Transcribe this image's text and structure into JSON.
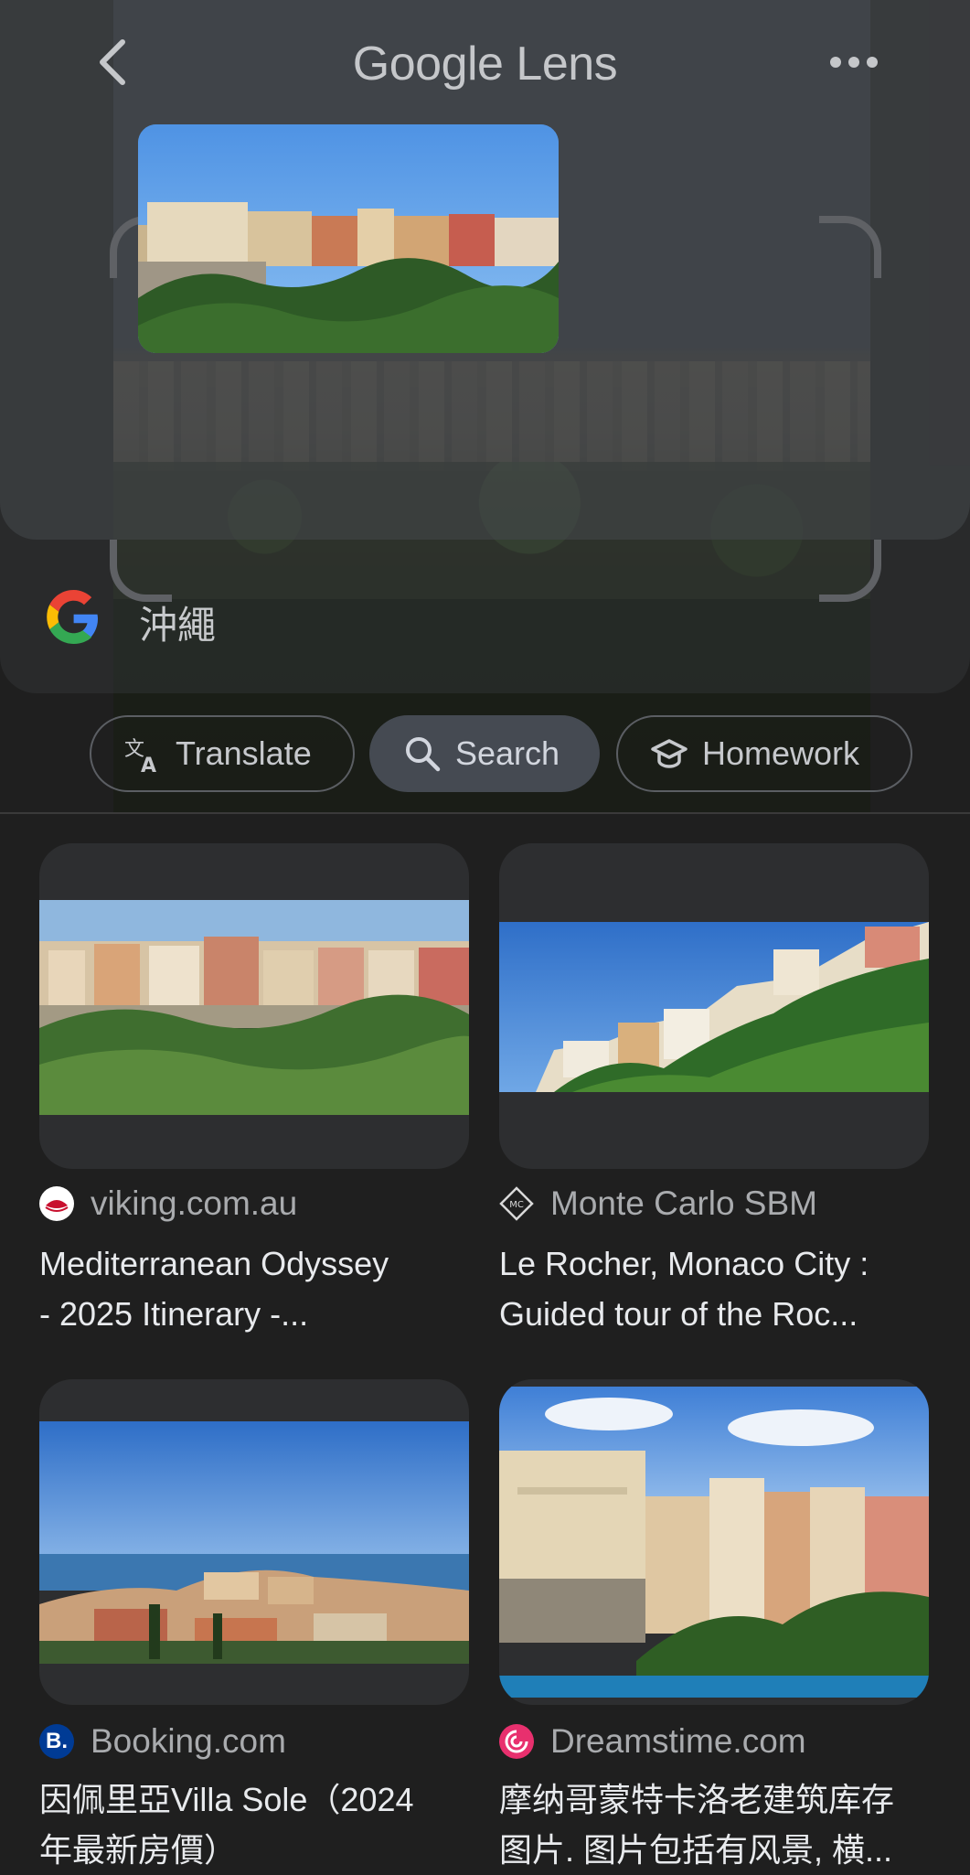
{
  "header": {
    "title": "Google Lens",
    "back_icon": "chevron-left-icon",
    "more_icon": "more-horizontal-icon"
  },
  "query": {
    "text": "沖繩"
  },
  "chips": [
    {
      "label": "Translate",
      "icon": "translate-icon"
    },
    {
      "label": "Search",
      "icon": "search-icon"
    },
    {
      "label": "Homework",
      "icon": "graduation-cap-icon"
    }
  ],
  "results": [
    {
      "source": "viking.com.au",
      "title_line1": "Mediterranean Odyssey",
      "title_line2": "- 2025 Itinerary -..."
    },
    {
      "source": "Monte Carlo SBM",
      "title_line1": "Le Rocher, Monaco City :",
      "title_line2": "Guided tour of the Roc..."
    },
    {
      "source": "Booking.com",
      "title_line1": "因佩里亞Villa Sole（2024",
      "title_line2": "年最新房價）"
    },
    {
      "source": "Dreamstime.com",
      "title_line1": "摩纳哥蒙特卡洛老建筑库存",
      "title_line2": "图片. 图片包括有风景, 横..."
    }
  ],
  "colors": {
    "background": "#1f1f1f",
    "chip_active": "#454a52",
    "text_primary": "#e8eaed",
    "text_secondary": "#a9abae"
  }
}
